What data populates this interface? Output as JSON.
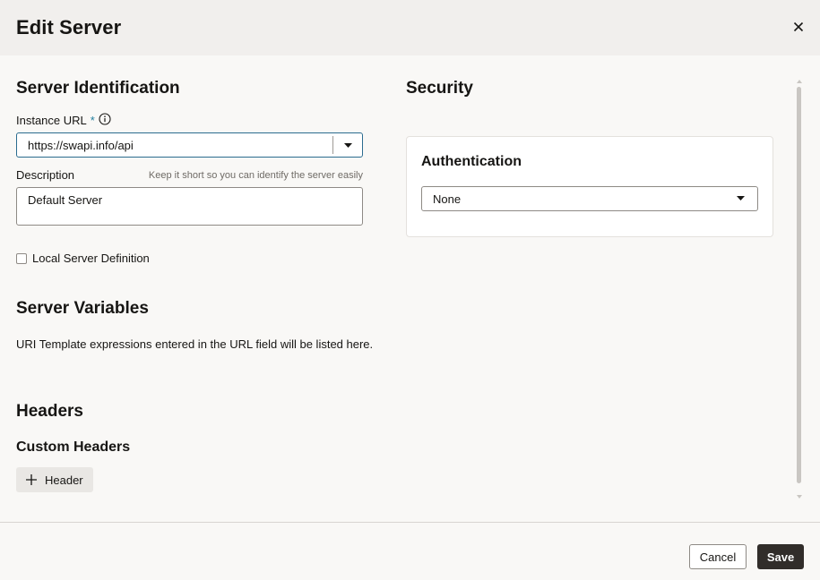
{
  "dialog": {
    "title": "Edit Server"
  },
  "identification": {
    "title": "Server Identification",
    "instance_url_label": "Instance URL",
    "required_mark": "*",
    "instance_url_value": "https://swapi.info/api",
    "description_label": "Description",
    "description_hint": "Keep it short so you can identify the server easily",
    "description_value": "Default Server",
    "local_definition_label": "Local Server Definition",
    "local_definition_checked": false
  },
  "variables": {
    "title": "Server Variables",
    "info": "URI Template expressions entered in the URL field will be listed here."
  },
  "headers": {
    "title": "Headers",
    "custom_title": "Custom Headers",
    "add_label": "Header"
  },
  "security": {
    "title": "Security",
    "auth_title": "Authentication",
    "auth_value": "None"
  },
  "footer": {
    "cancel_label": "Cancel",
    "save_label": "Save"
  },
  "colors": {
    "primary_button": "#312d2a",
    "focus_border": "#2b6c8f",
    "required": "#227e9e"
  },
  "icons": [
    "close-icon",
    "info-icon",
    "chevron-down-icon",
    "plus-icon"
  ]
}
